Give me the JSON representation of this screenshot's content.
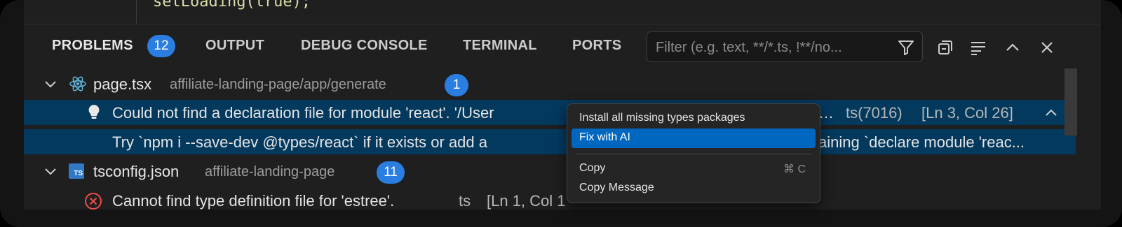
{
  "tabs": {
    "problems": "PROBLEMS",
    "problems_count": "12",
    "output": "OUTPUT",
    "debug_console": "DEBUG CONSOLE",
    "terminal": "TERMINAL",
    "ports": "PORTS"
  },
  "filter": {
    "placeholder": "Filter (e.g. text, **/*.ts, !**/no..."
  },
  "problems": {
    "file1": {
      "name": "page.tsx",
      "path": "affiliate-landing-page/app/generate",
      "count": "1"
    },
    "item1": {
      "message_start": "Could not find a declaration file for module 'react'. '/User",
      "message_end": "…",
      "source": "ts(7016)",
      "location": "[Ln 3, Col 26]",
      "hint_start": "Try `npm i --save-dev @types/react` if it exists or add a",
      "hint_end": "aining `declare module 'reac..."
    },
    "file2": {
      "name": "tsconfig.json",
      "path": "affiliate-landing-page",
      "count": "11",
      "icon_label": "TS"
    },
    "item2": {
      "message": "Cannot find type definition file for 'estree'.",
      "source": "ts",
      "location": "[Ln 1, Col 1"
    }
  },
  "context_menu": {
    "items": [
      {
        "label": "Install all missing types packages"
      },
      {
        "label": "Fix with AI"
      },
      {
        "label": "Copy",
        "shortcut": "⌘ C"
      },
      {
        "label": "Copy Message"
      }
    ]
  },
  "colors": {
    "accent": "#2a7de1",
    "selection": "#04395e",
    "menu_highlight": "#0067c0",
    "error": "#f14c4c"
  }
}
